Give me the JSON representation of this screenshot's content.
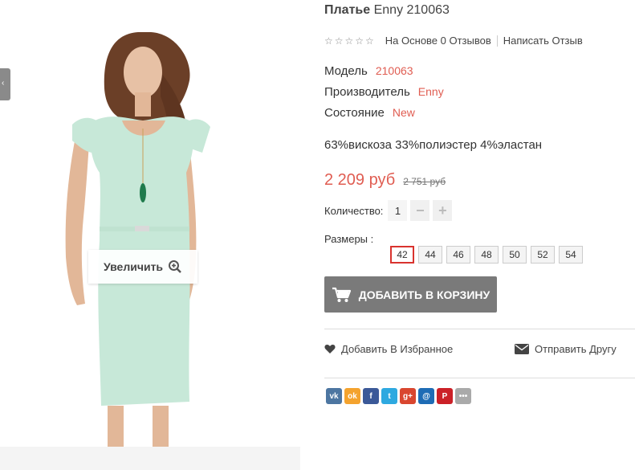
{
  "product": {
    "title_bold": "Платье",
    "title_rest": "Enny 210063",
    "stars": "☆☆☆☆☆",
    "reviews_label": "На Основе 0 Отзывов",
    "write_review_label": "Написать Отзыв",
    "specs": [
      {
        "label": "Модель",
        "value": "210063"
      },
      {
        "label": "Производитель",
        "value": "Enny"
      },
      {
        "label": "Состояние",
        "value": "New"
      }
    ],
    "composition": "63%вискоза 33%полиэстер 4%эластан",
    "price": "2 209 руб",
    "old_price": "2 751 руб",
    "quantity_label": "Количество:",
    "quantity_value": "1",
    "qty_minus": "−",
    "qty_plus": "+",
    "sizes_label": "Размеры :",
    "sizes": [
      "42",
      "44",
      "46",
      "48",
      "50",
      "52",
      "54"
    ],
    "selected_size": "42",
    "add_to_cart_label": "ДОБАВИТЬ В КОРЗИНУ",
    "wishlist_label": "Добавить В Избранное",
    "send_friend_label": "Отправить Другу"
  },
  "gallery": {
    "zoom_label": "Увеличить"
  },
  "share": [
    {
      "name": "vk-icon",
      "glyph": "vk",
      "color": "#4d76a1"
    },
    {
      "name": "odnoklassniki-icon",
      "glyph": "ok",
      "color": "#f4a32e"
    },
    {
      "name": "facebook-icon",
      "glyph": "f",
      "color": "#3b5998"
    },
    {
      "name": "twitter-icon",
      "glyph": "t",
      "color": "#2ea9e0"
    },
    {
      "name": "googleplus-icon",
      "glyph": "g+",
      "color": "#d9462f"
    },
    {
      "name": "mailru-icon",
      "glyph": "@",
      "color": "#1e6cb5"
    },
    {
      "name": "pinterest-icon",
      "glyph": "P",
      "color": "#cb2027"
    },
    {
      "name": "more-icon",
      "glyph": "•••",
      "color": "#aaaaaa"
    }
  ],
  "colors": {
    "accent": "#e05d52",
    "button": "#7a7a7a",
    "selected_border": "#d9332e"
  }
}
